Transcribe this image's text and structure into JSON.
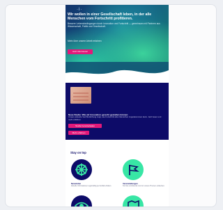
{
  "hero": {
    "logo": "·i·",
    "title": "Wir wollen in einer Gesellschaft leben, in der alle Menschen vom Fortschritt profitieren.",
    "text": "Bessere Lebensbedingungen durch Innovation und Fortschritt — gemeinsam mit Partnern aus Wissenschaft, Politik und Gesellschaft.",
    "subtext": "Mehr über unsere Arbeit erfahren",
    "button": "Jetzt informieren"
  },
  "feature": {
    "title": "Neue Studie: Wie wir Innovation gerecht gestalten können",
    "text": "Unsere aktuelle Veröffentlichung zeigt, wie Fortschritt allen Menschen zugutekommen kann. Jetzt lesen und mehr erfahren.",
    "button1": "Studie herunterladen",
    "button2": "Mehr erfahren"
  },
  "stay": {
    "title": "Stay on top",
    "items": [
      {
        "label": "Newsletter",
        "text": "Aktuelle Informationen regelmäßig per E-Mail erhalten.",
        "icon": "network-icon"
      },
      {
        "label": "Veranstaltungen",
        "text": "Termine und Events rund um unsere Themen entdecken.",
        "icon": "flag-icon"
      },
      {
        "label": "",
        "text": "",
        "icon": "eye-icon"
      },
      {
        "label": "",
        "text": "",
        "icon": "map-icon"
      }
    ]
  },
  "colors": {
    "navy": "#0d0b68",
    "mint": "#38e6a5",
    "pink": "#e2197a",
    "teal": "#17836f"
  }
}
